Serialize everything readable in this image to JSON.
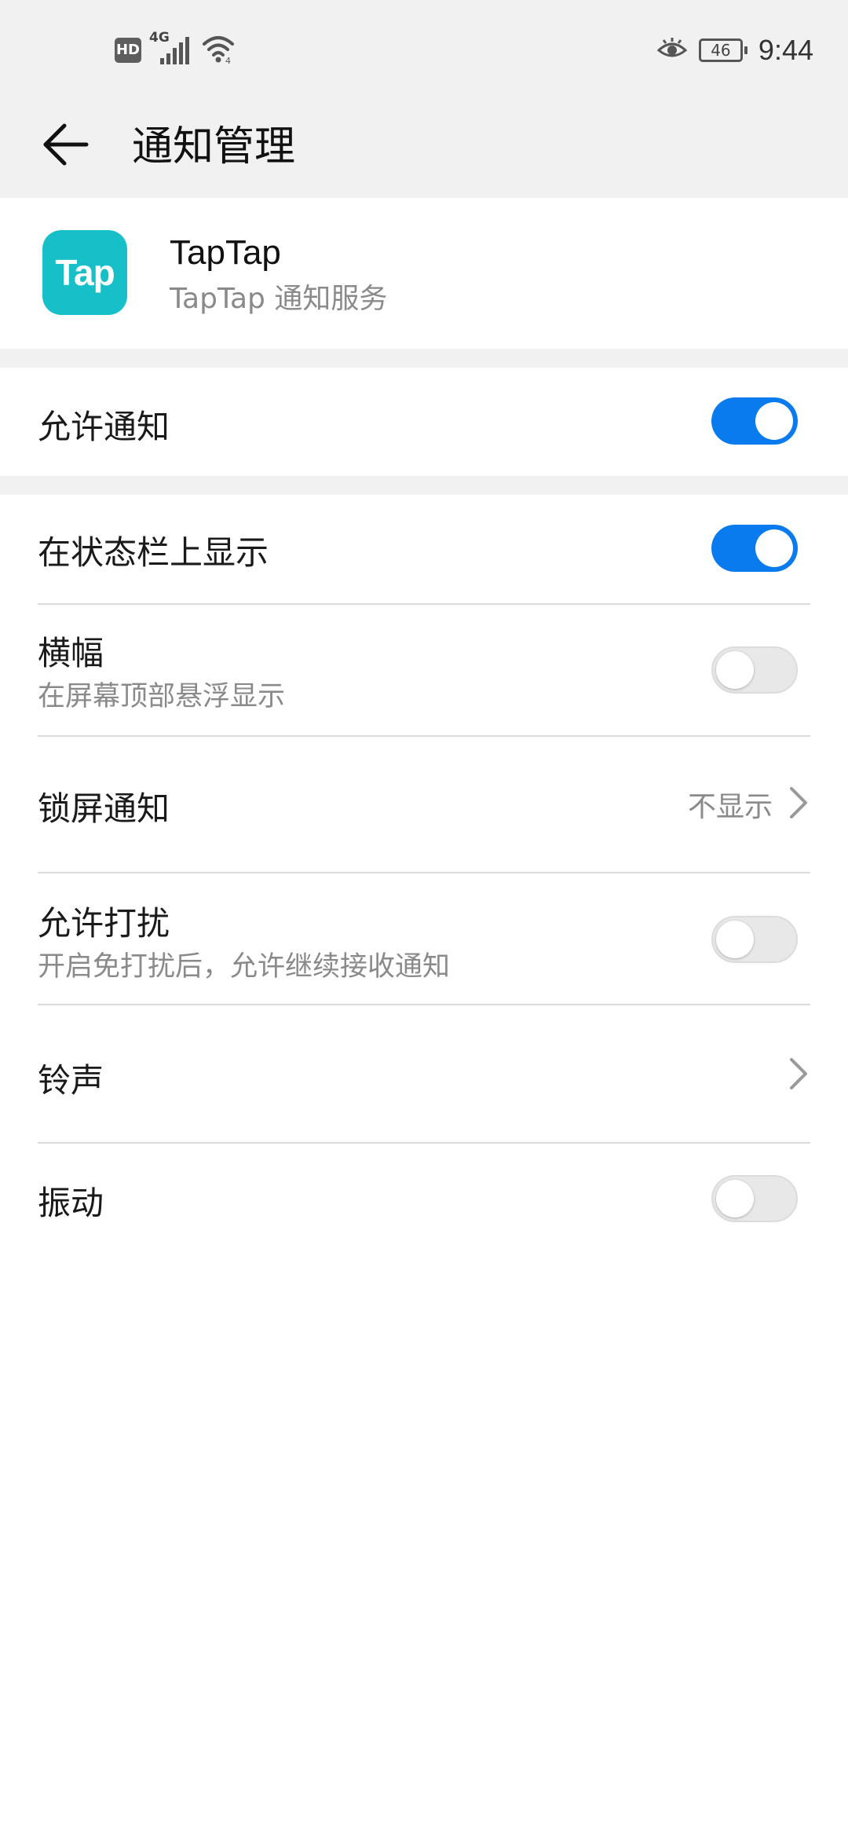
{
  "status_bar": {
    "hd_label": "HD",
    "network_label": "4G",
    "battery_level": "46",
    "time": "9:44"
  },
  "header": {
    "title": "通知管理"
  },
  "app": {
    "icon_text": "Tap",
    "name": "TapTap",
    "subtitle": "TapTap 通知服务"
  },
  "settings": {
    "allow_notifications": {
      "label": "允许通知",
      "enabled": true
    },
    "show_in_status_bar": {
      "label": "在状态栏上显示",
      "enabled": true
    },
    "banner": {
      "label": "横幅",
      "description": "在屏幕顶部悬浮显示",
      "enabled": false
    },
    "lock_screen": {
      "label": "锁屏通知",
      "value": "不显示"
    },
    "allow_interrupt": {
      "label": "允许打扰",
      "description": "开启免打扰后，允许继续接收通知",
      "enabled": false
    },
    "ringtone": {
      "label": "铃声"
    },
    "vibration": {
      "label": "振动",
      "enabled": false
    }
  },
  "colors": {
    "accent": "#0a7bef",
    "app_icon_bg": "#17c0c9",
    "header_bg": "#f1f1f1",
    "secondary_text": "#8a8a8a"
  }
}
